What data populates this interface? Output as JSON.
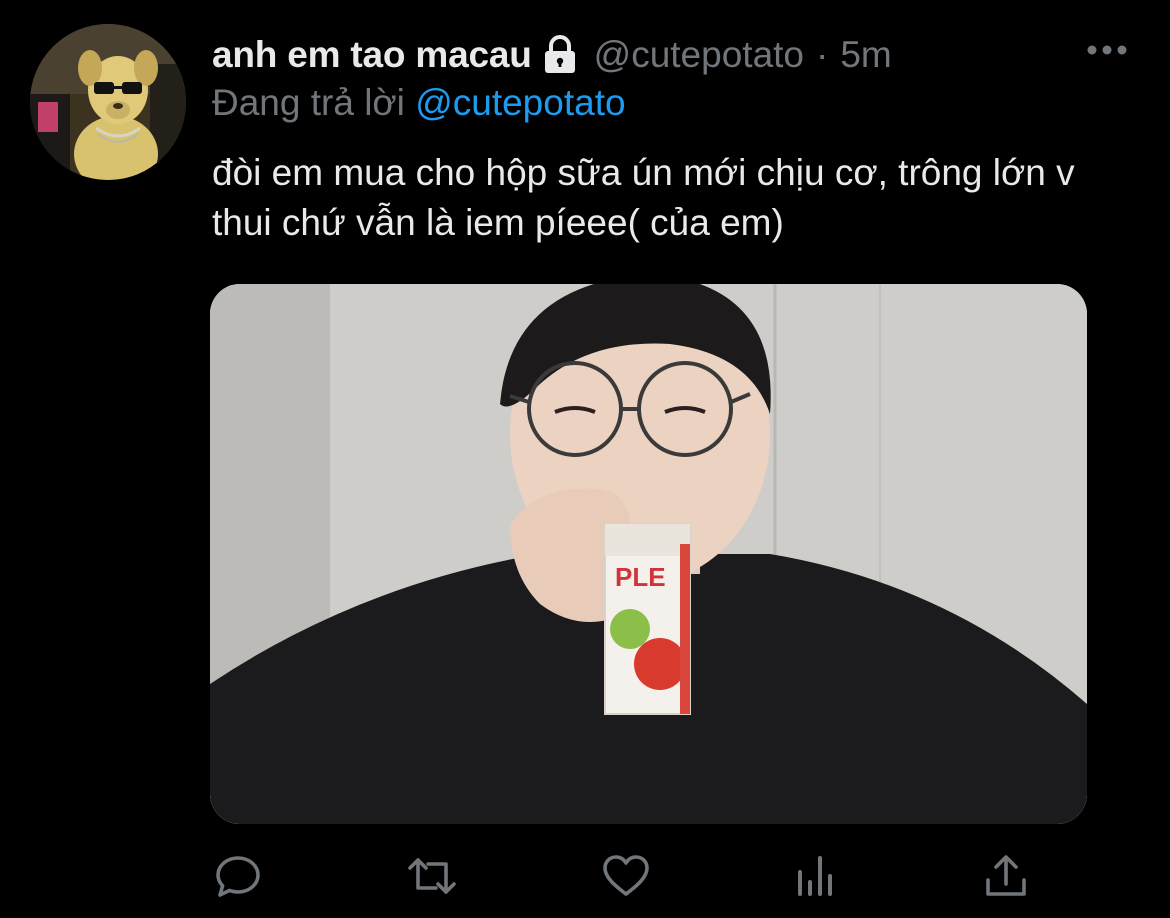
{
  "tweet": {
    "display_name": "anh em tao macau",
    "handle": "@cutepotato",
    "separator": "·",
    "time": "5m",
    "reply": {
      "prefix": "Đang trả lời",
      "mention": "@cutepotato"
    },
    "text": "đòi em mua cho hộp sữa ún mới chịu cơ, trông lớn v thui chứ vẫn là iem píeee( của em)",
    "media_text": "PLE"
  },
  "icons": {
    "lock": "lock-icon",
    "more": "more-icon",
    "reply": "reply-icon",
    "retweet": "retweet-icon",
    "like": "heart-icon",
    "views": "views-icon",
    "share": "share-icon"
  },
  "colors": {
    "background": "#000000",
    "primary_text": "#e7e9ea",
    "secondary_text": "#71767b",
    "link": "#1d9bf0"
  }
}
